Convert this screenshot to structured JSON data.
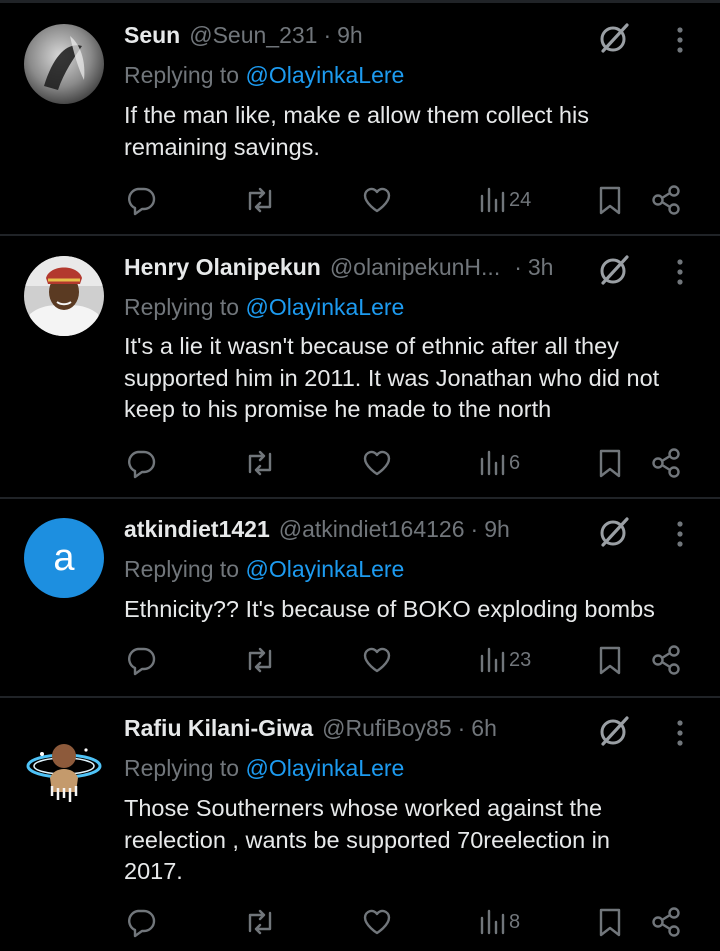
{
  "tweets": [
    {
      "display_name": "Seun",
      "handle": "@Seun_231",
      "time": "9h",
      "replying_prefix": "Replying to",
      "replying_to": "@OlayinkaLere",
      "text": "If the man like, make e allow them collect his remaining savings.",
      "views": "24",
      "avatar": "bw-photo-avatar"
    },
    {
      "display_name": "Henry Olanipekun",
      "handle": "@olanipekunH...",
      "time": "3h",
      "replying_prefix": "Replying to",
      "replying_to": "@OlayinkaLere",
      "text": "It's a lie it wasn't because of ethnic after all they supported him in 2011. It was Jonathan who did not keep to his promise he made to the north",
      "views": "6",
      "avatar": "man-in-cap-avatar"
    },
    {
      "display_name": "atkindiet1421",
      "handle": "@atkindiet164126",
      "time": "9h",
      "replying_prefix": "Replying to",
      "replying_to": "@OlayinkaLere",
      "text": "Ethnicity?? It's because of BOKO exploding bombs",
      "views": "23",
      "avatar_letter": "a",
      "avatar_color": "#1d8fe0"
    },
    {
      "display_name": "Rafiu Kilani-Giwa",
      "handle": "@RufiBoy85",
      "time": "6h",
      "replying_prefix": "Replying to",
      "replying_to": "@OlayinkaLere",
      "text": "Those Southerners whose  worked against the reelection , wants be supported 70reelection in 2017.",
      "views": "8",
      "avatar": "halo-portrait-avatar"
    }
  ],
  "separator": "·",
  "colors": {
    "background": "#000000",
    "text": "#e7e9ea",
    "muted": "#71767b",
    "link": "#1d9bf0",
    "divider": "#202327"
  },
  "icons": [
    "reply-icon",
    "retweet-icon",
    "like-icon",
    "views-icon",
    "bookmark-icon",
    "share-icon",
    "grok-icon",
    "more-icon"
  ]
}
